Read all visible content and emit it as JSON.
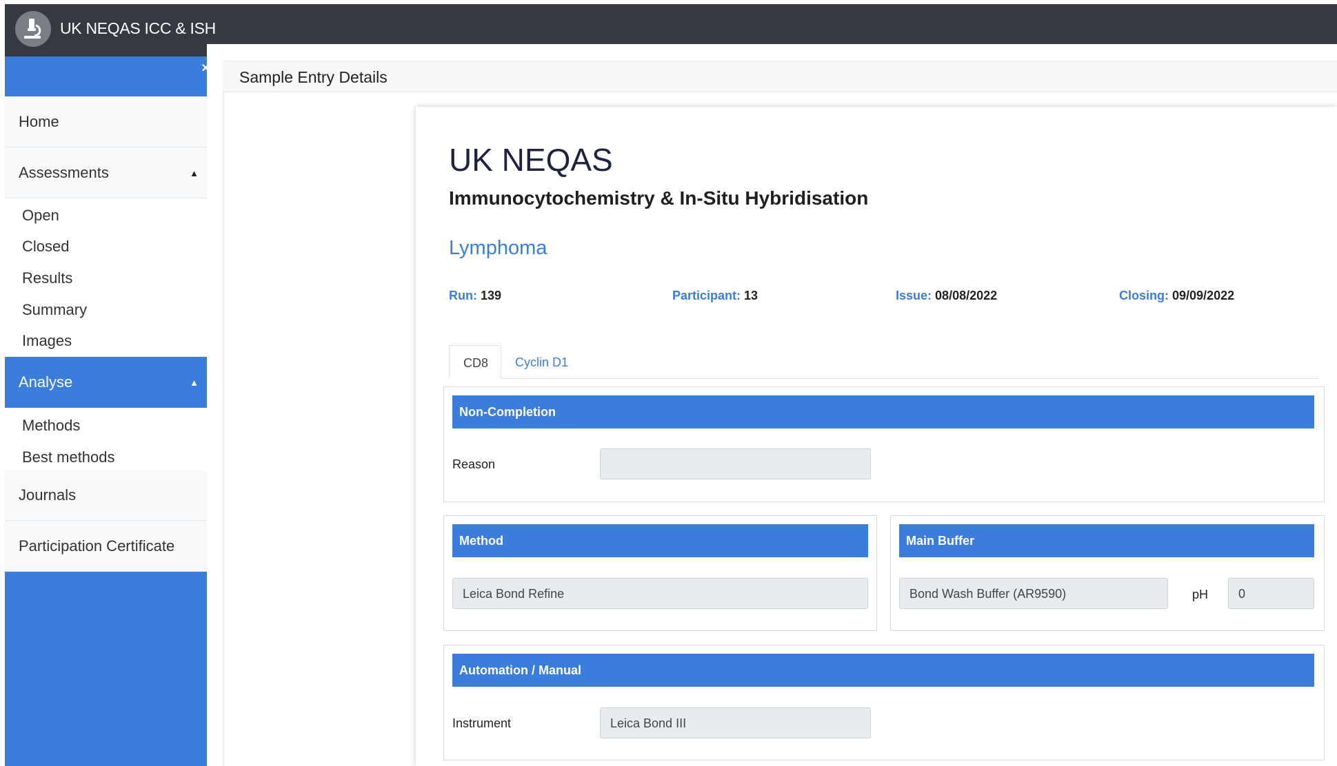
{
  "app": {
    "title": "UK NEQAS ICC & ISH",
    "logo_icon": "microscope-icon"
  },
  "sidebar": {
    "close_glyph": "×",
    "items": {
      "home": {
        "label": "Home"
      },
      "assessments": {
        "label": "Assessments",
        "caret": "▲"
      },
      "analyse": {
        "label": "Analyse",
        "caret": "▲"
      },
      "journals": {
        "label": "Journals"
      },
      "certificate": {
        "label": "Participation Certificate"
      }
    },
    "assessments_sub": {
      "open": "Open",
      "closed": "Closed",
      "results": "Results",
      "summary": "Summary",
      "images": "Images"
    },
    "analyse_sub": {
      "methods": "Methods",
      "best_methods": "Best methods"
    }
  },
  "page": {
    "breadcrumb": "Sample Entry Details"
  },
  "header": {
    "org": "UK NEQAS",
    "subtitle": "Immunocytochemistry & In-Situ Hybridisation",
    "programme": "Lymphoma"
  },
  "meta": {
    "run": {
      "label": "Run:",
      "value": "139"
    },
    "participant": {
      "label": "Participant:",
      "value": "13"
    },
    "issue": {
      "label": "Issue:",
      "value": "08/08/2022"
    },
    "closing": {
      "label": "Closing:",
      "value": "09/09/2022"
    }
  },
  "tabs": {
    "cd8": "CD8",
    "cyclin": "Cyclin D1"
  },
  "non_completion": {
    "title": "Non-Completion",
    "reason_label": "Reason",
    "reason_value": ""
  },
  "method": {
    "title": "Method",
    "value": "Leica Bond Refine"
  },
  "main_buffer": {
    "title": "Main Buffer",
    "value": "Bond Wash Buffer (AR9590)",
    "ph_label": "pH",
    "ph_value": "0"
  },
  "automation": {
    "title": "Automation / Manual",
    "instrument_label": "Instrument",
    "instrument_value": "Leica Bond III"
  },
  "colors": {
    "accent": "#3b7ddd",
    "topbar": "#343a40",
    "field_bg": "#e9ecef"
  }
}
